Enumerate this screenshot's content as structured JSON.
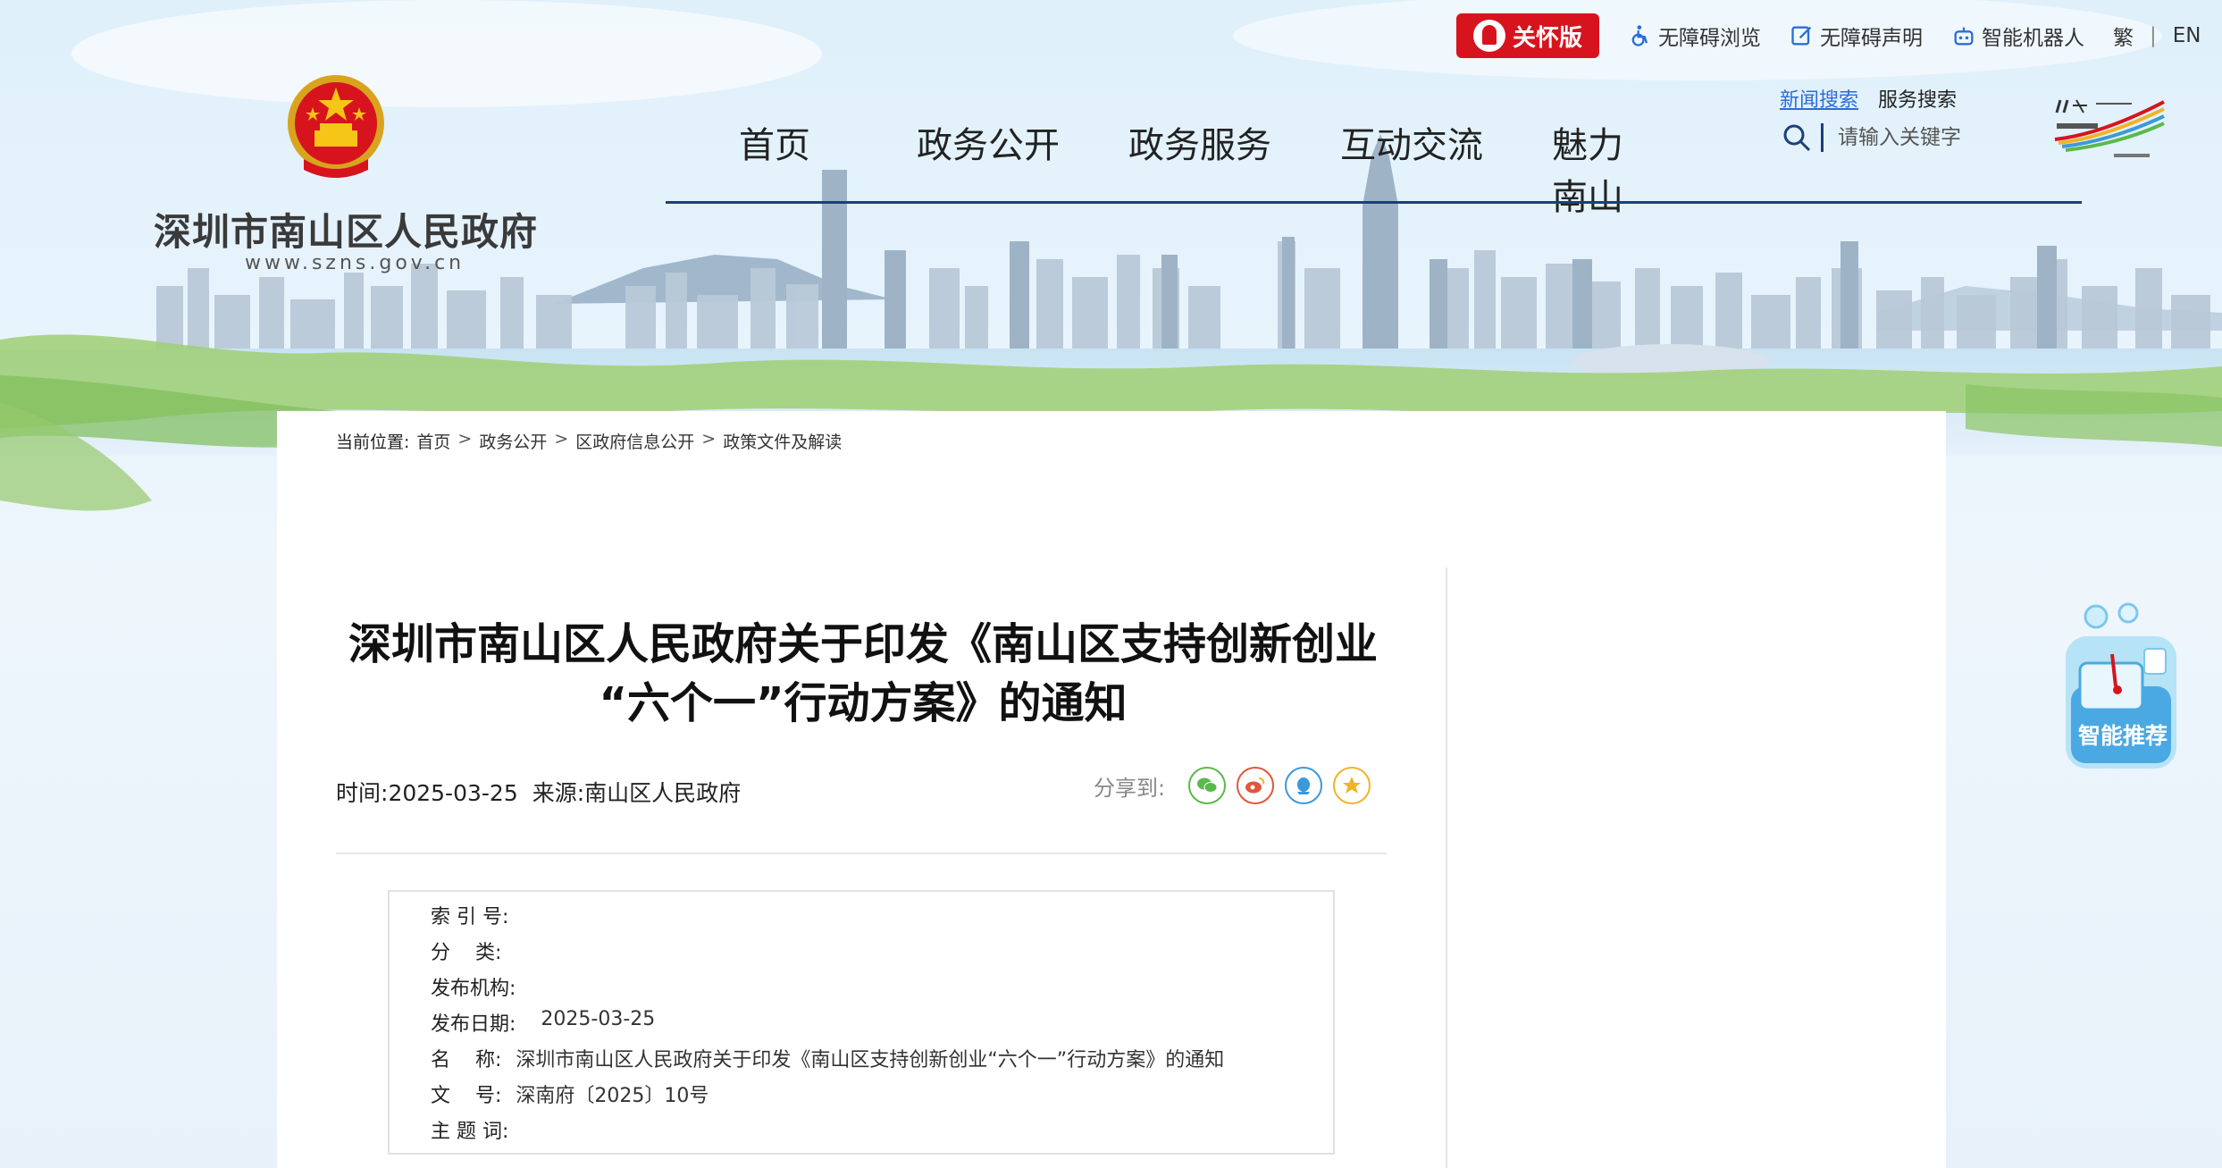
{
  "util": {
    "care_label": "关怀版",
    "accessible_browse": "无障碍浏览",
    "accessible_statement": "无障碍声明",
    "robot": "智能机器人",
    "traditional": "繁",
    "english": "EN"
  },
  "site": {
    "name": "深圳市南山区人民政府",
    "url": "www.szns.gov.cn"
  },
  "nav": {
    "items": [
      {
        "label": "首页"
      },
      {
        "label": "政务公开"
      },
      {
        "label": "政务服务"
      },
      {
        "label": "互动交流"
      },
      {
        "label": "魅力南山"
      }
    ]
  },
  "search": {
    "news_link": "新闻搜索",
    "service_link": "服务搜索",
    "placeholder": "请输入关键字"
  },
  "breadcrumb": {
    "label": "当前位置:",
    "items": [
      "首页",
      "政务公开",
      "区政府信息公开",
      "政策文件及解读"
    ],
    "sep": ">"
  },
  "article": {
    "title_line1": "深圳市南山区人民政府关于印发《南山区支持创新创业",
    "title_line2": "“六个一”行动方案》的通知",
    "time_label": "时间:",
    "time": "2025-03-25",
    "source_label": "来源:",
    "source": "南山区人民政府",
    "share_label": "分享到:"
  },
  "info_table": [
    {
      "key": "索 引 号:",
      "value": ""
    },
    {
      "key": "分    类:",
      "value": ""
    },
    {
      "key": "发布机构:",
      "value": ""
    },
    {
      "key": "发布日期:",
      "value": "2025-03-25"
    },
    {
      "key": "名    称:",
      "value": "深圳市南山区人民政府关于印发《南山区支持创新创业“六个一”行动方案》的通知"
    },
    {
      "key": "文    号:",
      "value": "深南府〔2025〕10号"
    },
    {
      "key": "主 题 词:",
      "value": ""
    }
  ],
  "float_widget": {
    "label": "智能推荐"
  },
  "colors": {
    "care_red": "#d7141d",
    "nav_line": "#1c3f7a",
    "link_blue": "#2b6dd8",
    "wechat": "#5bb94b",
    "weibo": "#e0573b",
    "qq": "#3a9ad9",
    "favorite": "#f0b429"
  }
}
